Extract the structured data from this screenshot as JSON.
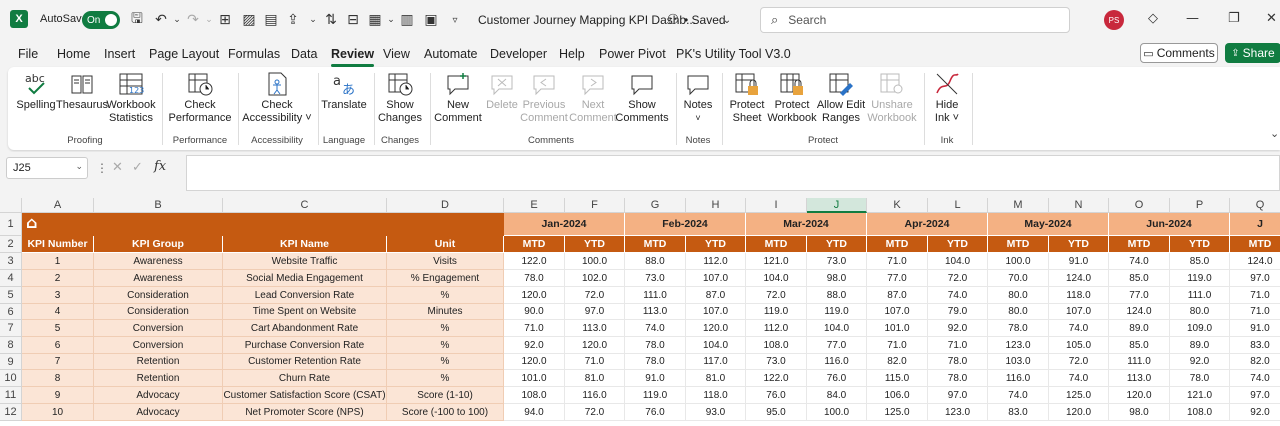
{
  "titlebar": {
    "app_logo": "X",
    "autosave_label": "AutoSave",
    "autosave_state": "On",
    "doc_title": "Customer Journey Mapping KPI Dashb...",
    "saved_status": "• Saved",
    "search_placeholder": "Search",
    "avatar_initials": "PS"
  },
  "menu": [
    "File",
    "Home",
    "Insert",
    "Page Layout",
    "Formulas",
    "Data",
    "Review",
    "View",
    "Automate",
    "Developer",
    "Help",
    "Power Pivot",
    "PK's Utility Tool V3.0"
  ],
  "active_menu": "Review",
  "header_buttons": {
    "comments": "Comments",
    "share": "Share"
  },
  "ribbon": {
    "buttons": {
      "spelling": "Spelling",
      "thesaurus": "Thesaurus",
      "workbook_statistics_1": "Workbook",
      "workbook_statistics_2": "Statistics",
      "check_performance_1": "Check",
      "check_performance_2": "Performance",
      "check_accessibility_1": "Check",
      "check_accessibility_2": "Accessibility ˅",
      "translate": "Translate",
      "show_changes_1": "Show",
      "show_changes_2": "Changes",
      "new_comment_1": "New",
      "new_comment_2": "Comment",
      "delete": "Delete",
      "previous_comment_1": "Previous",
      "previous_comment_2": "Comment",
      "next_comment_1": "Next",
      "next_comment_2": "Comment",
      "show_comments_1": "Show",
      "show_comments_2": "Comments",
      "notes": "Notes",
      "protect_sheet_1": "Protect",
      "protect_sheet_2": "Sheet",
      "protect_workbook_1": "Protect",
      "protect_workbook_2": "Workbook",
      "allow_edit_ranges_1": "Allow Edit",
      "allow_edit_ranges_2": "Ranges",
      "unshare_workbook_1": "Unshare",
      "unshare_workbook_2": "Workbook",
      "hide_ink_1": "Hide",
      "hide_ink_2": "Ink ˅"
    },
    "groups": {
      "proofing": "Proofing",
      "performance": "Performance",
      "accessibility": "Accessibility",
      "language": "Language",
      "changes": "Changes",
      "comments": "Comments",
      "notes": "Notes",
      "protect": "Protect",
      "ink": "Ink"
    }
  },
  "formula_bar": {
    "name_box": "J25",
    "fx": "fx",
    "value": ""
  },
  "sheet": {
    "columns": [
      "A",
      "B",
      "C",
      "D",
      "E",
      "F",
      "G",
      "H",
      "I",
      "J",
      "K",
      "L",
      "M",
      "N",
      "O",
      "P",
      "Q"
    ],
    "selected_column": "J",
    "row_numbers": [
      "1",
      "2",
      "3",
      "4",
      "5",
      "6",
      "7",
      "8",
      "9",
      "10",
      "11",
      "12"
    ],
    "headers": [
      "KPI Number",
      "KPI Group",
      "KPI Name",
      "Unit"
    ],
    "months": [
      "Jan-2024",
      "Feb-2024",
      "Mar-2024",
      "Apr-2024",
      "May-2024",
      "Jun-2024",
      "J"
    ],
    "mtd_label": "MTD",
    "ytd_label": "YTD",
    "rows": [
      {
        "num": "1",
        "group": "Awareness",
        "name": "Website Traffic",
        "unit": "Visits",
        "vals": [
          "122.0",
          "100.0",
          "88.0",
          "112.0",
          "121.0",
          "73.0",
          "71.0",
          "104.0",
          "100.0",
          "91.0",
          "74.0",
          "85.0",
          "124.0"
        ]
      },
      {
        "num": "2",
        "group": "Awareness",
        "name": "Social Media Engagement",
        "unit": "% Engagement",
        "vals": [
          "78.0",
          "102.0",
          "73.0",
          "107.0",
          "104.0",
          "98.0",
          "77.0",
          "72.0",
          "70.0",
          "124.0",
          "85.0",
          "119.0",
          "97.0"
        ]
      },
      {
        "num": "3",
        "group": "Consideration",
        "name": "Lead Conversion Rate",
        "unit": "%",
        "vals": [
          "120.0",
          "72.0",
          "111.0",
          "87.0",
          "72.0",
          "88.0",
          "87.0",
          "74.0",
          "80.0",
          "118.0",
          "77.0",
          "111.0",
          "71.0"
        ]
      },
      {
        "num": "4",
        "group": "Consideration",
        "name": "Time Spent on Website",
        "unit": "Minutes",
        "vals": [
          "90.0",
          "97.0",
          "113.0",
          "107.0",
          "119.0",
          "119.0",
          "107.0",
          "79.0",
          "80.0",
          "107.0",
          "124.0",
          "80.0",
          "71.0"
        ]
      },
      {
        "num": "5",
        "group": "Conversion",
        "name": "Cart Abandonment Rate",
        "unit": "%",
        "vals": [
          "71.0",
          "113.0",
          "74.0",
          "120.0",
          "112.0",
          "104.0",
          "101.0",
          "92.0",
          "78.0",
          "74.0",
          "89.0",
          "109.0",
          "91.0"
        ]
      },
      {
        "num": "6",
        "group": "Conversion",
        "name": "Purchase Conversion Rate",
        "unit": "%",
        "vals": [
          "92.0",
          "120.0",
          "78.0",
          "104.0",
          "108.0",
          "77.0",
          "71.0",
          "71.0",
          "123.0",
          "105.0",
          "85.0",
          "89.0",
          "83.0"
        ]
      },
      {
        "num": "7",
        "group": "Retention",
        "name": "Customer Retention Rate",
        "unit": "%",
        "vals": [
          "120.0",
          "71.0",
          "78.0",
          "117.0",
          "73.0",
          "116.0",
          "82.0",
          "78.0",
          "103.0",
          "72.0",
          "111.0",
          "92.0",
          "82.0"
        ]
      },
      {
        "num": "8",
        "group": "Retention",
        "name": "Churn Rate",
        "unit": "%",
        "vals": [
          "101.0",
          "81.0",
          "91.0",
          "81.0",
          "122.0",
          "76.0",
          "115.0",
          "78.0",
          "116.0",
          "74.0",
          "113.0",
          "78.0",
          "74.0"
        ]
      },
      {
        "num": "9",
        "group": "Advocacy",
        "name": "Customer Satisfaction Score (CSAT)",
        "unit": "Score (1-10)",
        "vals": [
          "108.0",
          "116.0",
          "119.0",
          "118.0",
          "76.0",
          "84.0",
          "106.0",
          "97.0",
          "74.0",
          "125.0",
          "120.0",
          "121.0",
          "97.0"
        ]
      },
      {
        "num": "10",
        "group": "Advocacy",
        "name": "Net Promoter Score (NPS)",
        "unit": "Score (-100 to 100)",
        "vals": [
          "94.0",
          "72.0",
          "76.0",
          "93.0",
          "95.0",
          "100.0",
          "125.0",
          "123.0",
          "83.0",
          "120.0",
          "98.0",
          "108.0",
          "92.0"
        ]
      }
    ]
  },
  "colors": {
    "accent": "#107c41",
    "header_orange": "#c55a11",
    "month_peach": "#f4b183",
    "kpi_fill": "#fbe5d6"
  }
}
